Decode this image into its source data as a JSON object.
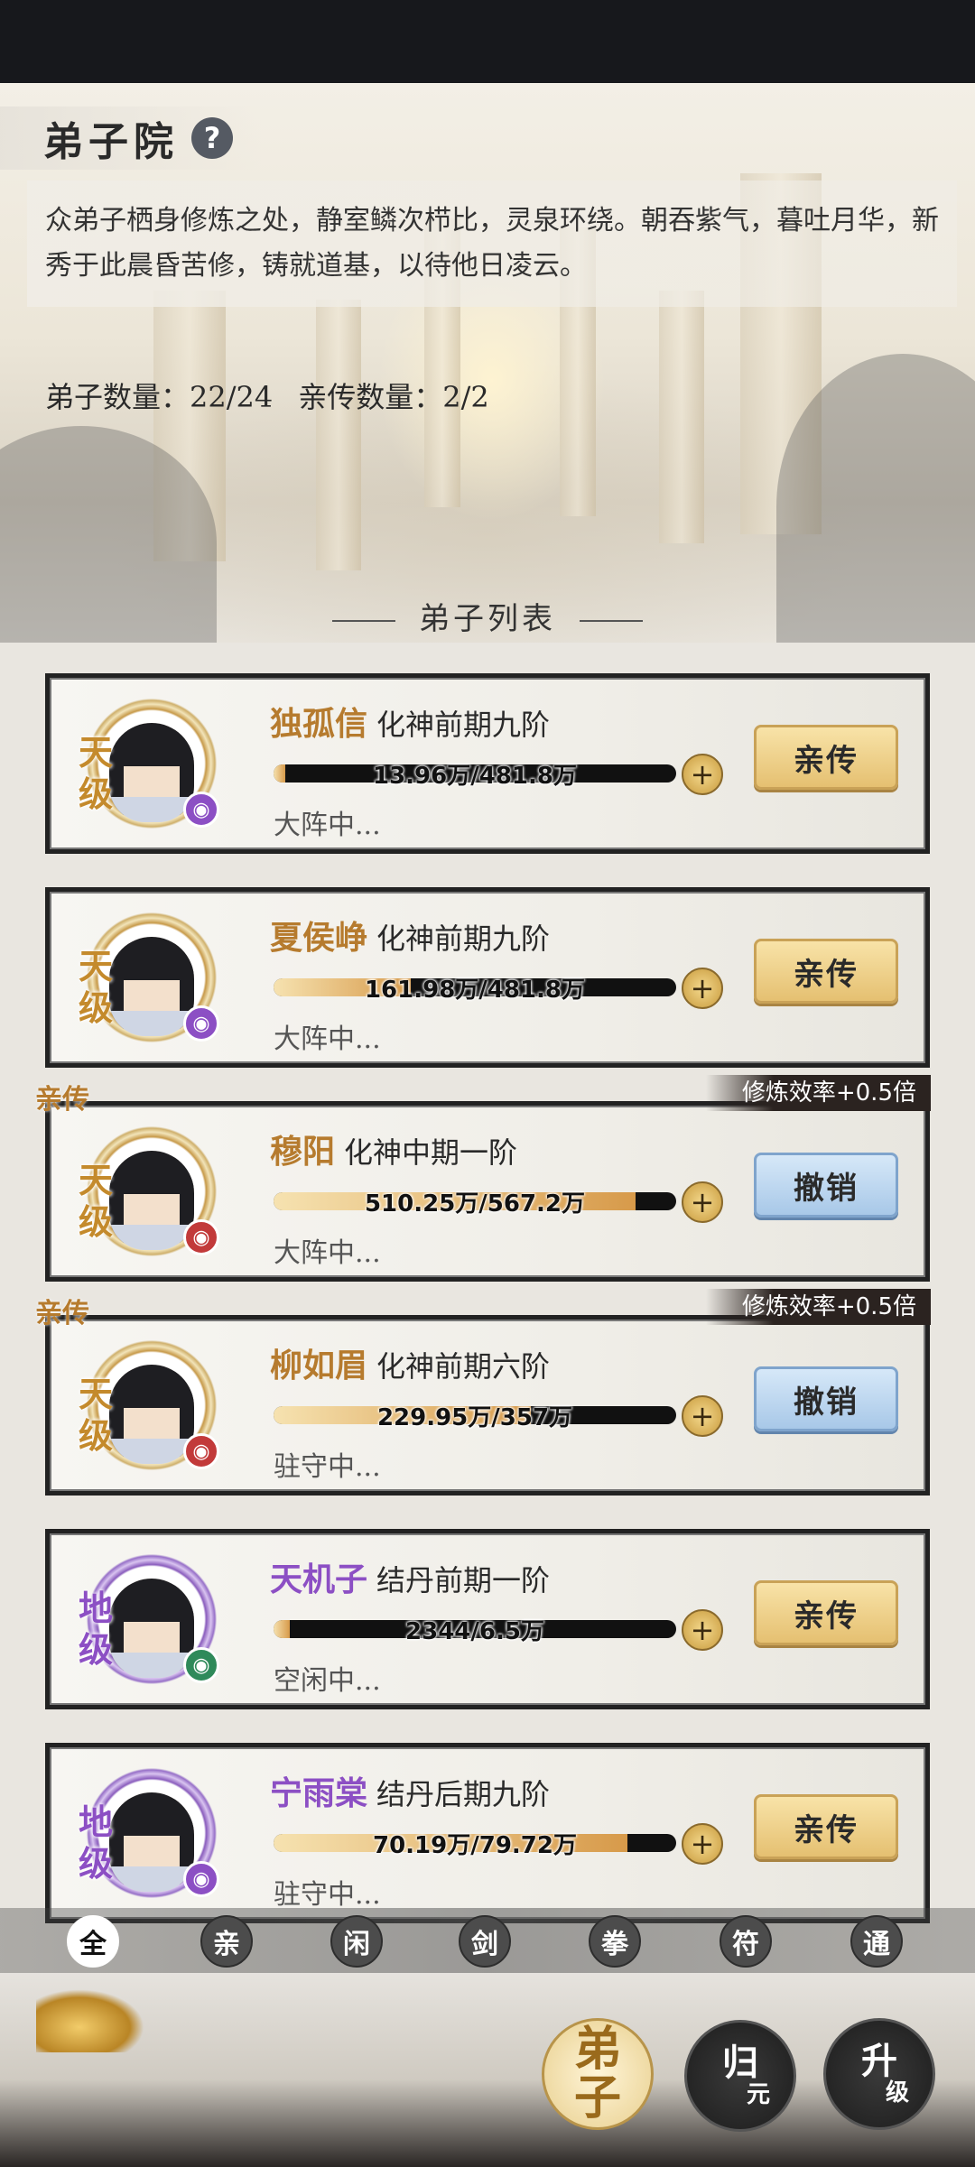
{
  "header": {
    "title": "弟子院",
    "help": "?",
    "description": "众弟子栖身修炼之处，静室鳞次栉比，灵泉环绕。朝吞紫气，暮吐月华，新秀于此晨昏苦修，铸就道基，以待他日凌云。",
    "disciple_count": "弟子数量：22/24",
    "direct_count": "亲传数量：2/2"
  },
  "list_title": "弟子列表",
  "disciples": [
    {
      "grade": "天级",
      "name": "独孤信",
      "realm": "化神前期九阶",
      "progress_text": "13.96万/481.8万",
      "progress": 0.03,
      "status": "大阵中...",
      "action": "亲传",
      "direct": false,
      "buff": ""
    },
    {
      "grade": "天级",
      "name": "夏侯峥",
      "realm": "化神前期九阶",
      "progress_text": "161.98万/481.8万",
      "progress": 0.34,
      "status": "大阵中...",
      "action": "亲传",
      "direct": false,
      "buff": ""
    },
    {
      "grade": "天级",
      "name": "穆阳",
      "realm": "化神中期一阶",
      "progress_text": "510.25万/567.2万",
      "progress": 0.9,
      "status": "大阵中...",
      "action": "撤销",
      "direct": true,
      "direct_label": "亲传",
      "buff": "修炼效率+0.5倍"
    },
    {
      "grade": "天级",
      "name": "柳如眉",
      "realm": "化神前期六阶",
      "progress_text": "229.95万/357万",
      "progress": 0.64,
      "status": "驻守中...",
      "action": "撤销",
      "direct": true,
      "direct_label": "亲传",
      "buff": "修炼效率+0.5倍"
    },
    {
      "grade": "地级",
      "name": "天机子",
      "realm": "结丹前期一阶",
      "progress_text": "2344/6.5万",
      "progress": 0.04,
      "status": "空闲中...",
      "action": "亲传",
      "direct": false,
      "buff": ""
    },
    {
      "grade": "地级",
      "name": "宁雨棠",
      "realm": "结丹后期九阶",
      "progress_text": "70.19万/79.72万",
      "progress": 0.88,
      "status": "驻守中...",
      "action": "亲传",
      "direct": false,
      "buff": ""
    }
  ],
  "filters": [
    "全",
    "亲",
    "闲",
    "剑",
    "拳",
    "符",
    "通"
  ],
  "bottom_nav": {
    "disciple": "弟子",
    "guiyuan_main": "归",
    "guiyuan_sub": "元",
    "upgrade_main": "升",
    "upgrade_sub": "级"
  },
  "colors": {
    "gold_name": "#b67b2e",
    "purple_name": "#8c4fc4",
    "direct_tag": "#b67b2e"
  },
  "icons": {
    "help": "question-icon",
    "plus": "plus-icon"
  }
}
